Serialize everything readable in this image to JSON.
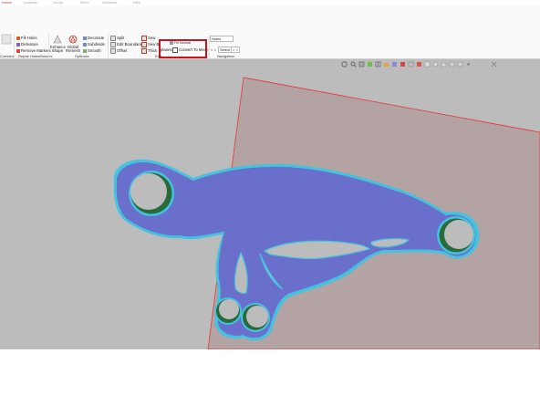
{
  "tabs": [
    {
      "label": "Home"
    },
    {
      "label": "Analysis"
    },
    {
      "label": "Sculpt"
    },
    {
      "label": "Mesh"
    },
    {
      "label": "Windows"
    },
    {
      "label": "Help"
    }
  ],
  "ribbon": {
    "groups": {
      "combine": "Combine",
      "repair": "Repair Holes/Bosses",
      "optimize": "Optimize",
      "edit": "Edit",
      "navigation": "Navigation"
    },
    "repair": {
      "fill_holes": "Fill Holes",
      "defeature": "Defeature",
      "remove_markers": "Remove Markers"
    },
    "optimize": {
      "enhance_shape": "Enhance Shape",
      "global_remesh": "Global Remesh",
      "decimate": "Decimate",
      "subdivide": "Subdivide",
      "smooth": "Smooth"
    },
    "edit": {
      "split": "Split",
      "edit_boundaries": "Edit Boundaries",
      "offset": "Offset",
      "sew": "Sew",
      "sew2": "Sew B",
      "thicken": "Thick",
      "fill_normal": "Fill Normal",
      "planes": "planes",
      "convert_to_mesh": "Convert To Mesh"
    },
    "navigation": {
      "holes_select": "Holes",
      "prev_left": "< <",
      "select": "Select",
      "next_right": "> >"
    }
  },
  "colors": {
    "highlight": "#c4161c",
    "part_fill": "#6a6fcc",
    "part_edge": "#42c3df",
    "plane_fill": "#b3a3a3",
    "plane_edge": "#e04545",
    "viewport_bg": "#bcbcbc",
    "hole_inner": "#2a6a3a"
  },
  "viewport_toolbar": {
    "icons": [
      "rotate-icon",
      "zoom-icon",
      "box-icon",
      "color-icon",
      "grid-icon",
      "layers-icon",
      "section-icon",
      "mirror-icon",
      "texture-icon",
      "measure-icon",
      "snap-icon",
      "light-icon",
      "camera-icon",
      "view-icon",
      "expand-icon",
      "more-icon",
      "close-icon"
    ]
  }
}
